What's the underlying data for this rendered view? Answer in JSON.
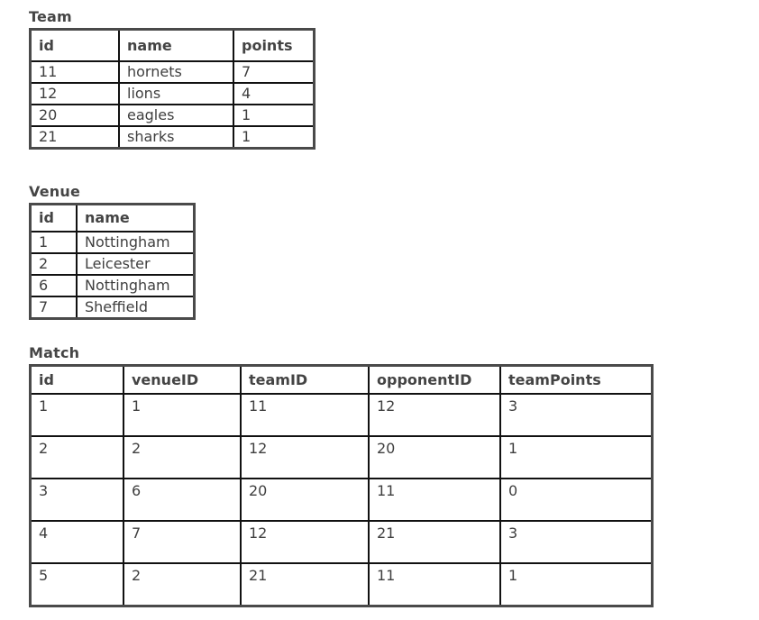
{
  "team": {
    "title": "Team",
    "columns": [
      "id",
      "name",
      "points"
    ],
    "rows": [
      [
        "11",
        "hornets",
        "7"
      ],
      [
        "12",
        "lions",
        "4"
      ],
      [
        "20",
        "eagles",
        "1"
      ],
      [
        "21",
        "sharks",
        "1"
      ]
    ]
  },
  "venue": {
    "title": "Venue",
    "columns": [
      "id",
      "name"
    ],
    "rows": [
      [
        "1",
        "Nottingham"
      ],
      [
        "2",
        "Leicester"
      ],
      [
        "6",
        "Nottingham"
      ],
      [
        "7",
        "Sheffield"
      ]
    ]
  },
  "match": {
    "title": "Match",
    "columns": [
      "id",
      "venueID",
      "teamID",
      "opponentID",
      "teamPoints"
    ],
    "rows": [
      [
        "1",
        "1",
        "11",
        "12",
        "3"
      ],
      [
        "2",
        "2",
        "12",
        "20",
        "1"
      ],
      [
        "3",
        "6",
        "20",
        "11",
        "0"
      ],
      [
        "4",
        "7",
        "12",
        "21",
        "3"
      ],
      [
        "5",
        "2",
        "21",
        "11",
        "1"
      ]
    ]
  }
}
